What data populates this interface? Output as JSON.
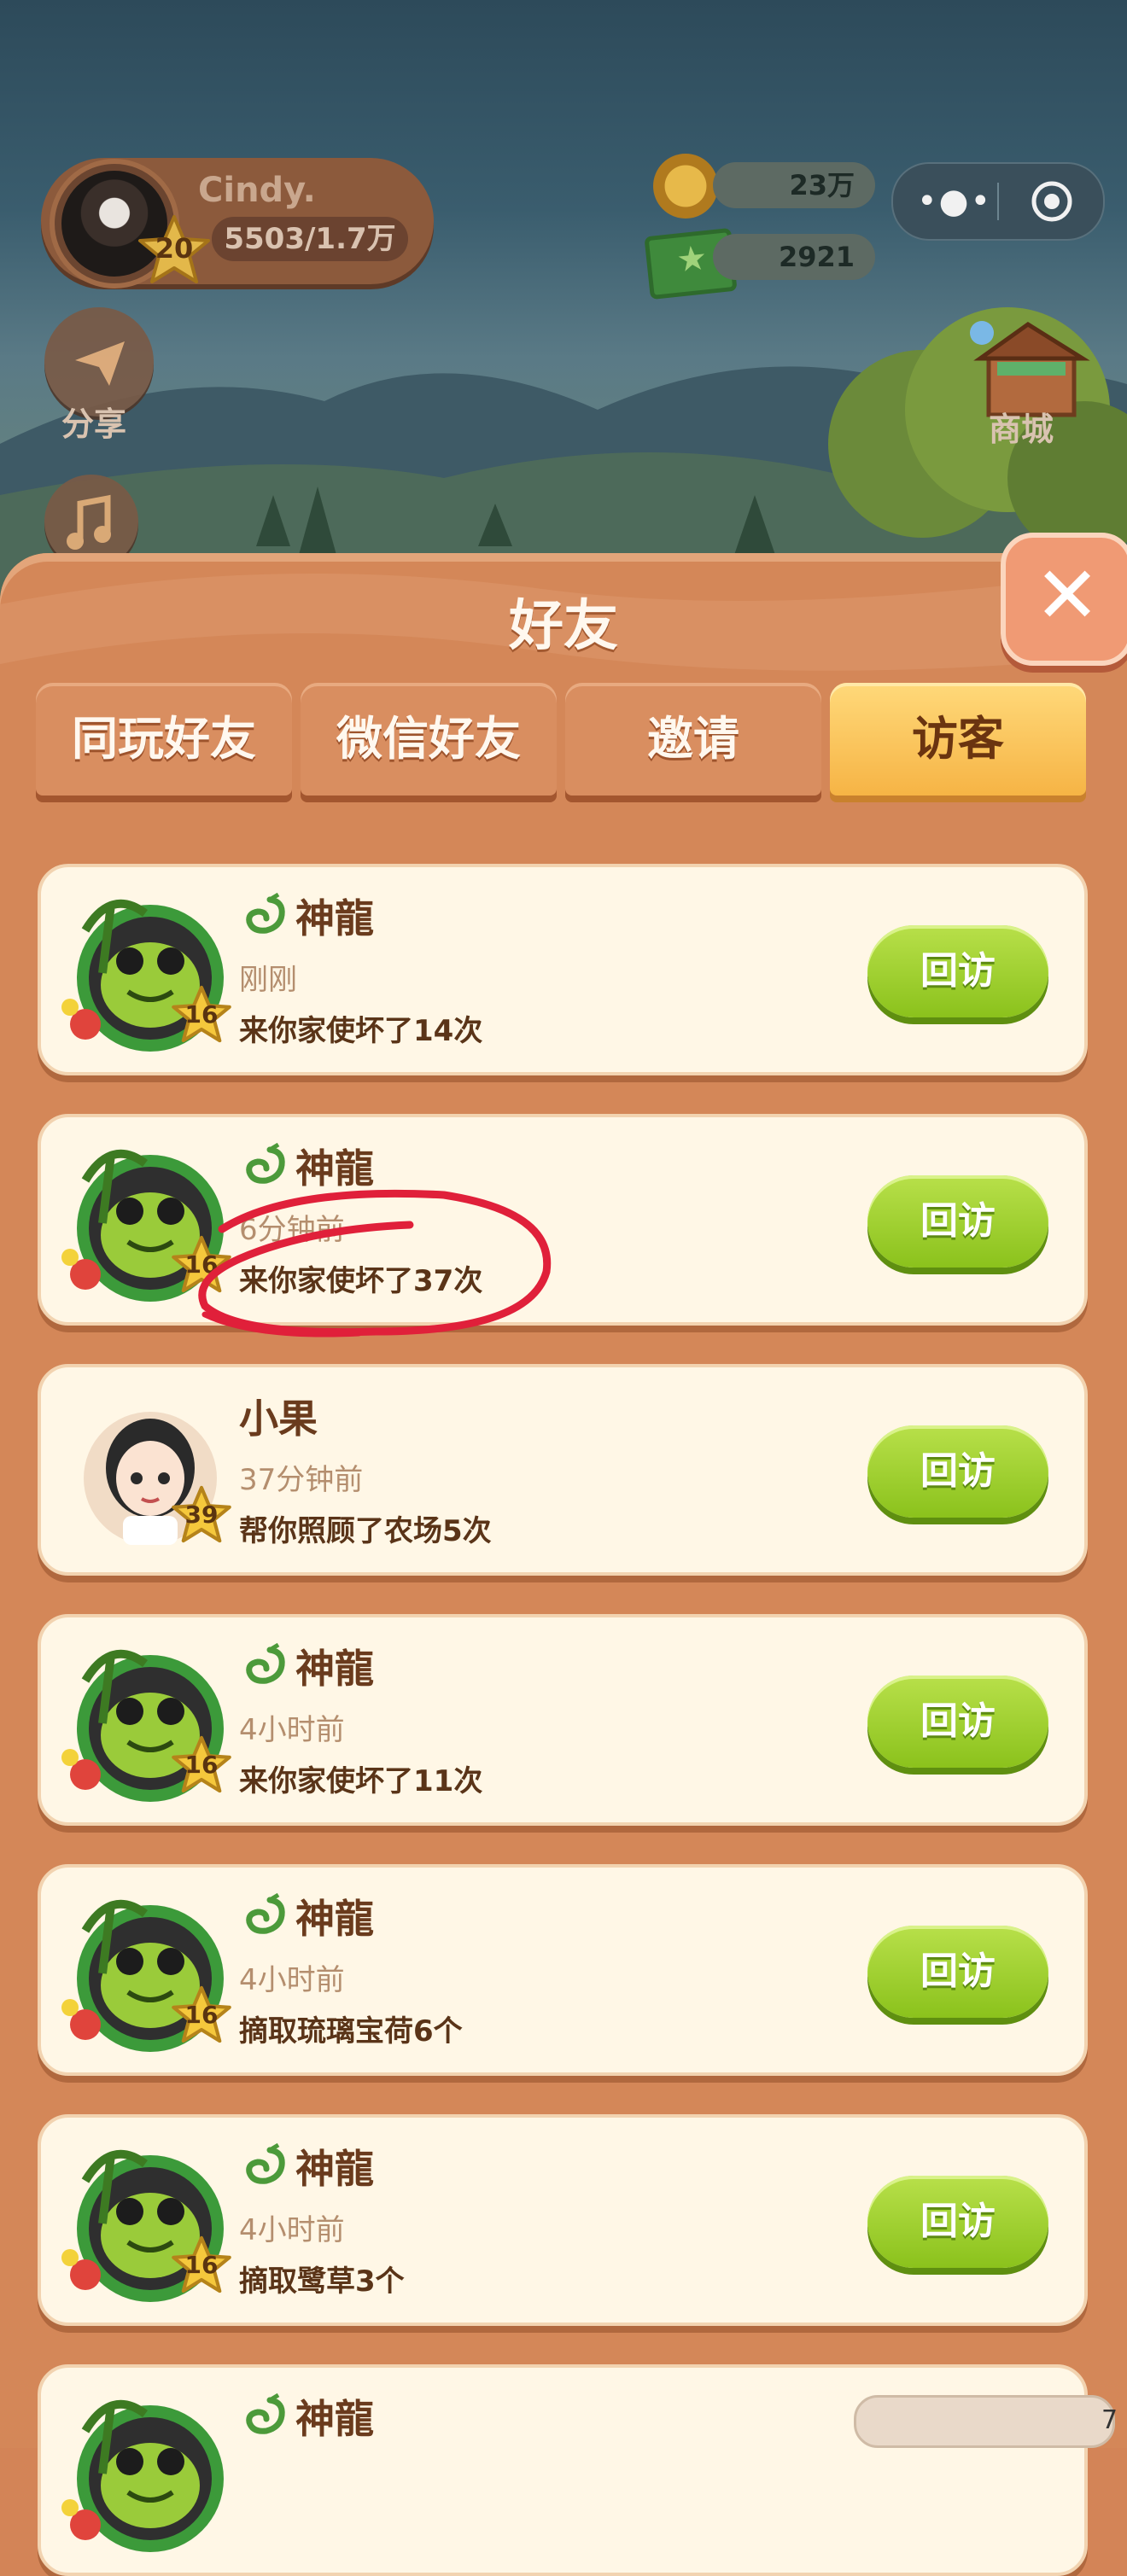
{
  "hud": {
    "player_name": "Cindy.",
    "player_level": "20",
    "exp": "5503/1.7万",
    "coins": "23万",
    "cash": "2921",
    "share_label": "分享",
    "shop_label": "商城"
  },
  "panel": {
    "title": "好友",
    "close_label": "✕",
    "tabs": [
      {
        "label": "同玩好友",
        "active": false
      },
      {
        "label": "微信好友",
        "active": false
      },
      {
        "label": "邀请",
        "active": false
      },
      {
        "label": "访客",
        "active": true
      }
    ],
    "revisit_label": "回访"
  },
  "visitors": [
    {
      "name": "神龍",
      "time": "刚刚",
      "action": "来你家使坏了14次",
      "level": "16",
      "avatar": "frog-avatar"
    },
    {
      "name": "神龍",
      "time": "6分钟前",
      "action": "来你家使坏了37次",
      "level": "16",
      "avatar": "frog-avatar"
    },
    {
      "name": "小果",
      "time": "37分钟前",
      "action": "帮你照顾了农场5次",
      "level": "39",
      "avatar": "girl-avatar"
    },
    {
      "name": "神龍",
      "time": "4小时前",
      "action": "来你家使坏了11次",
      "level": "16",
      "avatar": "frog-avatar"
    },
    {
      "name": "神龍",
      "time": "4小时前",
      "action": "摘取琉璃宝荷6个",
      "level": "16",
      "avatar": "frog-avatar"
    },
    {
      "name": "神龍",
      "time": "4小时前",
      "action": "摘取鹭草3个",
      "level": "16",
      "avatar": "frog-avatar"
    },
    {
      "name": "神龍",
      "time": "",
      "action": "",
      "level": "",
      "avatar": "frog-avatar"
    }
  ],
  "corner_number": "7",
  "colors": {
    "panel_bg": "#d48758",
    "card_bg": "#fff7e6",
    "active_tab": "#f6b445",
    "revisit_green": "#8bc21c",
    "annotation_red": "#e0203a"
  }
}
